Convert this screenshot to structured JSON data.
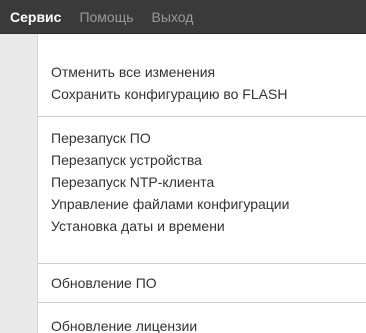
{
  "menubar": {
    "items": [
      {
        "label": "Сервис"
      },
      {
        "label": "Помощь"
      },
      {
        "label": "Выход"
      }
    ]
  },
  "dropdown": {
    "groups": [
      {
        "items": [
          {
            "label": "Отменить все изменения"
          },
          {
            "label": "Сохранить конфигурацию во FLASH"
          }
        ]
      },
      {
        "items": [
          {
            "label": "Перезапуск ПО"
          },
          {
            "label": "Перезапуск устройства"
          },
          {
            "label": "Перезапуск NTP-клиента"
          },
          {
            "label": "Управление файлами конфигурации"
          },
          {
            "label": "Установка даты и времени"
          }
        ]
      },
      {
        "items": [
          {
            "label": "Обновление ПО"
          }
        ]
      },
      {
        "items": [
          {
            "label": "Обновление лицензии"
          }
        ]
      }
    ]
  },
  "colors": {
    "menubar_bg": "#3a3a3a",
    "menubar_active_text": "#ffffff",
    "menubar_inactive_text": "#9a9a9a",
    "dropdown_bg": "#ffffff",
    "gutter_bg": "#e9e9e9",
    "item_text": "#333333",
    "separator": "#cfcfcf"
  }
}
